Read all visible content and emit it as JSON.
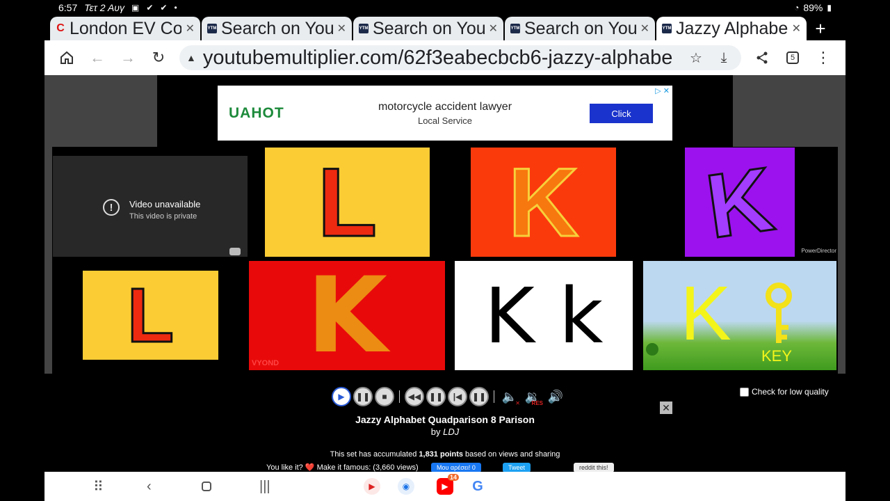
{
  "status_bar": {
    "time": "6:57",
    "date": "Τετ 2 Αυγ",
    "battery": "89%"
  },
  "tabs": [
    {
      "title": "London EV Co",
      "icon": "red-c-icon",
      "active": false
    },
    {
      "title": "Search on You",
      "icon": "ytm-icon",
      "active": false
    },
    {
      "title": "Search on You",
      "icon": "ytm-icon",
      "active": false
    },
    {
      "title": "Search on You",
      "icon": "ytm-icon",
      "active": false
    },
    {
      "title": "Jazzy Alphabe",
      "icon": "ytm-icon",
      "active": true
    }
  ],
  "toolbar": {
    "url": "youtubemultiplier.com/62f3eabecbcb6-jazzy-alphabe",
    "tab_count": "5"
  },
  "ad": {
    "brand": "UAHOT",
    "headline": "motorcycle accident lawyer",
    "subline": "Local Service",
    "cta": "Click"
  },
  "videos": {
    "unavailable_title": "Video unavailable",
    "unavailable_sub": "This video is private",
    "tile2_letter": "L",
    "tile3_letter": "K",
    "tile4_letter": "K",
    "tile4_watermark": "PowerDirector",
    "tile5_letter": "L",
    "tile6_letter": "K",
    "tile6_watermark": "VYOND",
    "tile7_letters": "K k",
    "tile8_letter": "K",
    "tile8_word": "KEY"
  },
  "controls": {
    "low_quality_label": "Check for low quality"
  },
  "set": {
    "title": "Jazzy Alphabet Quadparison 8 Parison",
    "by_prefix": "by",
    "author": "LDJ",
    "points_prefix": "This set has accumulated",
    "points_value": "1,831 points",
    "points_suffix": "based on views and sharing",
    "famous_text": "You like it? ❤️ Make it famous: (3,660 views)",
    "fb_label": "Μου αρέσει! 0",
    "tweet_label": "Tweet",
    "reddit_label": "reddit this!"
  },
  "navbar": {
    "youtube_badge": "14"
  }
}
